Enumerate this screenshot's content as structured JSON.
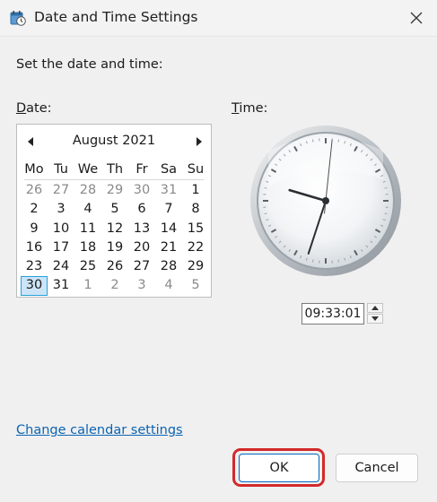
{
  "window": {
    "title": "Date and Time Settings"
  },
  "instruction": "Set the date and time:",
  "date_label": {
    "underlined": "D",
    "rest": "ate:"
  },
  "time_label": {
    "underlined": "T",
    "rest": "ime:"
  },
  "calendar": {
    "month_year": "August 2021",
    "day_names": [
      "Mo",
      "Tu",
      "We",
      "Th",
      "Fr",
      "Sa",
      "Su"
    ],
    "days": [
      {
        "d": "26",
        "other": true
      },
      {
        "d": "27",
        "other": true
      },
      {
        "d": "28",
        "other": true
      },
      {
        "d": "29",
        "other": true
      },
      {
        "d": "30",
        "other": true
      },
      {
        "d": "31",
        "other": true
      },
      {
        "d": "1",
        "other": false
      },
      {
        "d": "2",
        "other": false
      },
      {
        "d": "3",
        "other": false
      },
      {
        "d": "4",
        "other": false
      },
      {
        "d": "5",
        "other": false
      },
      {
        "d": "6",
        "other": false
      },
      {
        "d": "7",
        "other": false
      },
      {
        "d": "8",
        "other": false
      },
      {
        "d": "9",
        "other": false
      },
      {
        "d": "10",
        "other": false
      },
      {
        "d": "11",
        "other": false
      },
      {
        "d": "12",
        "other": false
      },
      {
        "d": "13",
        "other": false
      },
      {
        "d": "14",
        "other": false
      },
      {
        "d": "15",
        "other": false
      },
      {
        "d": "16",
        "other": false
      },
      {
        "d": "17",
        "other": false
      },
      {
        "d": "18",
        "other": false
      },
      {
        "d": "19",
        "other": false
      },
      {
        "d": "20",
        "other": false
      },
      {
        "d": "21",
        "other": false
      },
      {
        "d": "22",
        "other": false
      },
      {
        "d": "23",
        "other": false
      },
      {
        "d": "24",
        "other": false
      },
      {
        "d": "25",
        "other": false
      },
      {
        "d": "26",
        "other": false
      },
      {
        "d": "27",
        "other": false
      },
      {
        "d": "28",
        "other": false
      },
      {
        "d": "29",
        "other": false
      },
      {
        "d": "30",
        "other": false,
        "selected": true
      },
      {
        "d": "31",
        "other": false
      },
      {
        "d": "1",
        "other": true
      },
      {
        "d": "2",
        "other": true
      },
      {
        "d": "3",
        "other": true
      },
      {
        "d": "4",
        "other": true
      },
      {
        "d": "5",
        "other": true
      }
    ]
  },
  "clock": {
    "hours": 9,
    "minutes": 33,
    "seconds": 1
  },
  "time_value": "09:33:01",
  "change_calendar_link": "Change calendar settings",
  "buttons": {
    "ok": "OK",
    "cancel": "Cancel"
  },
  "colors": {
    "link": "#0a64b4",
    "selection": "#cce4f7",
    "selection_border": "#26a0da",
    "highlight": "#d32a2a",
    "accent": "#0067c0"
  },
  "icons": [
    "date-time-app-icon",
    "close-icon",
    "chevron-left-icon",
    "chevron-right-icon",
    "spin-up-icon",
    "spin-down-icon"
  ]
}
